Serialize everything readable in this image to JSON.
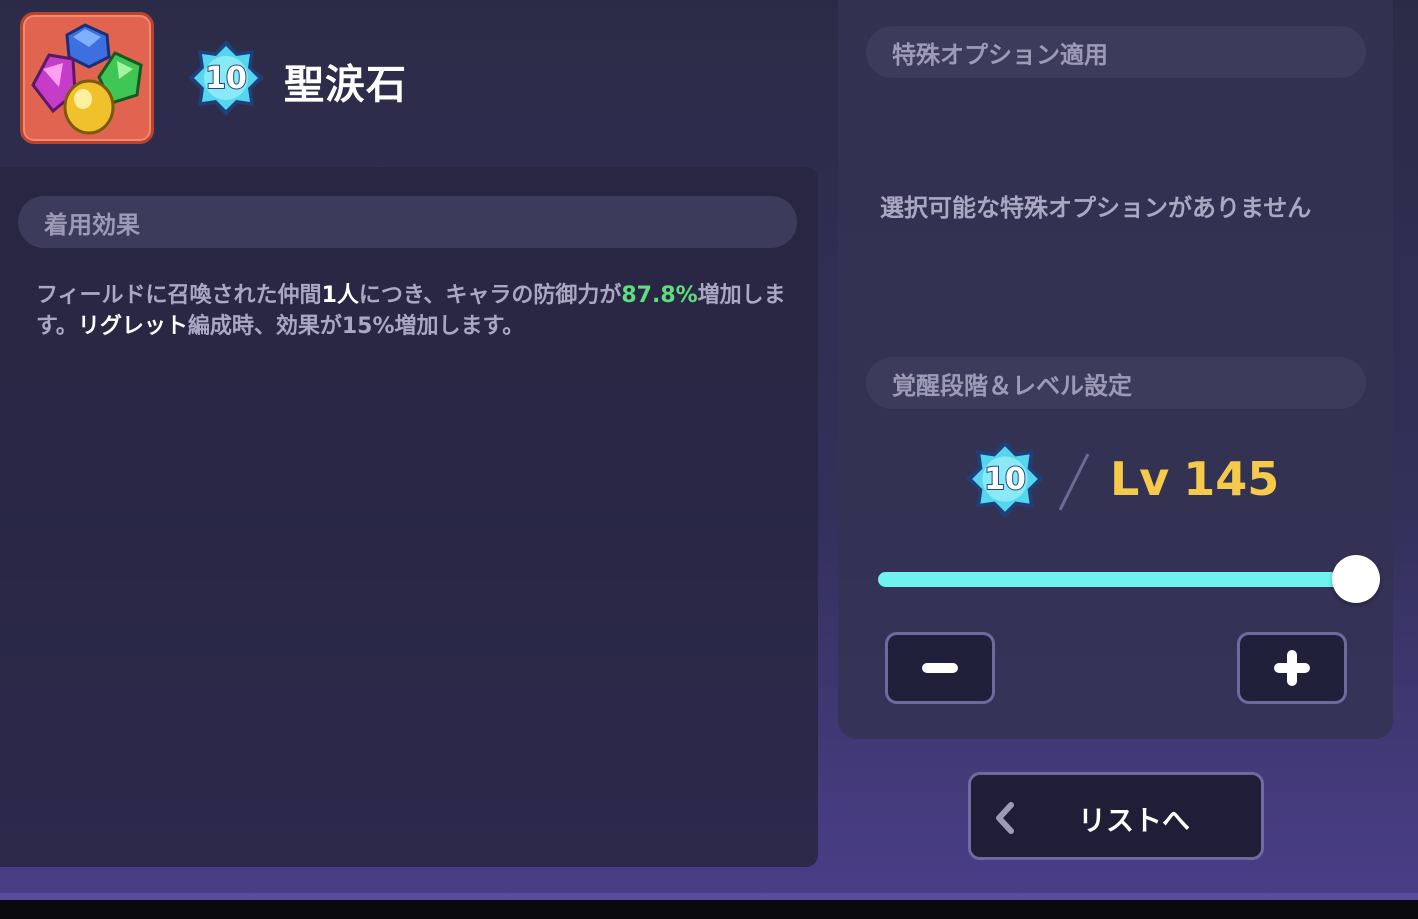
{
  "item": {
    "name": "聖涙石",
    "awakening_stage": "10",
    "icon": "gem-cluster-icon"
  },
  "equip_effect": {
    "header": "着用効果",
    "text_parts": {
      "p1": "フィールドに召喚された仲間",
      "p2": "1人",
      "p3": "につき、キャラの防御力が",
      "p4": "87.8%",
      "p5": "増加します。",
      "p6": "リグレット",
      "p7": "編成時、効果が15%増加します。"
    }
  },
  "special_option": {
    "header": "特殊オプション適用",
    "empty_message": "選択可能な特殊オプションがありません"
  },
  "level_settings": {
    "header": "覚醒段階＆レベル設定",
    "awakening_stage": "10",
    "lv_prefix": "Lv",
    "level": "145",
    "slider_fraction": 1.0,
    "minus_icon": "minus-icon",
    "plus_icon": "plus-icon"
  },
  "back_button": {
    "label": "リストへ",
    "icon": "chevron-left-icon"
  },
  "colors": {
    "accent_cyan": "#6ff3f2",
    "level_gold": "#f5c94a",
    "highlight_green": "#5fdc7f"
  }
}
